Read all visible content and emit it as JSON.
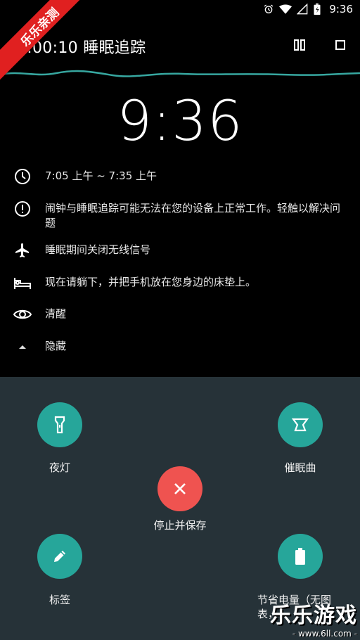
{
  "status_bar": {
    "time": "9:36"
  },
  "header": {
    "title": "0:00:10 睡眠追踪"
  },
  "clock": "9:36",
  "rows": [
    {
      "icon": "clock-icon",
      "text": "7:05 上午 ~ 7:35 上午"
    },
    {
      "icon": "alert-circle-icon",
      "text": "闹钟与睡眠追踪可能无法在您的设备上正常工作。轻触以解决问题"
    },
    {
      "icon": "airplane-icon",
      "text": "睡眠期间关闭无线信号"
    },
    {
      "icon": "bed-icon",
      "text": "现在请躺下，并把手机放在您身边的床垫上。"
    },
    {
      "icon": "eye-icon",
      "text": "清醒"
    },
    {
      "icon": "collapse-arrow-icon",
      "text": "隐藏"
    }
  ],
  "actions": {
    "night_light": "夜灯",
    "lullaby": "催眠曲",
    "stop_save": "停止并保存",
    "tag": "标签",
    "power_save": "节省电量（无图表，"
  },
  "watermark": {
    "ribbon": "乐乐亲测",
    "brand": "乐乐游戏",
    "url": "- www.6ll.com -"
  },
  "colors": {
    "accent_teal": "#26a69a",
    "stop_red": "#ef5350",
    "sheet_bg": "#263238"
  }
}
